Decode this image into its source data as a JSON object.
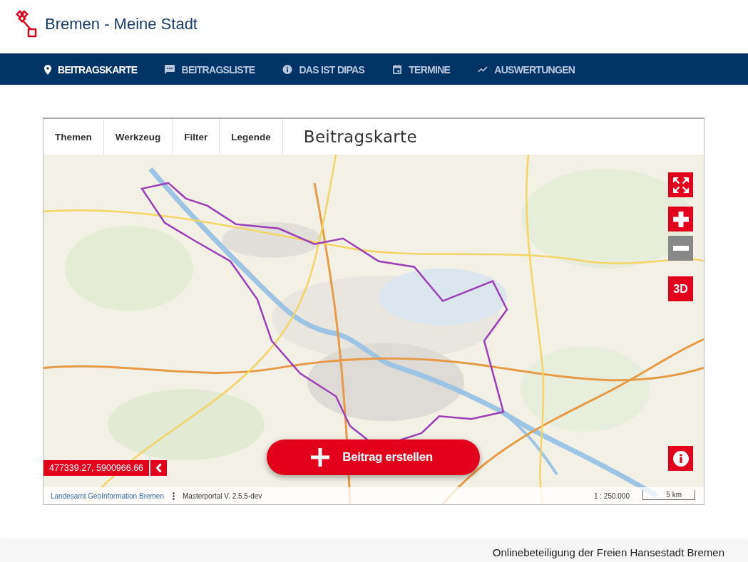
{
  "header": {
    "title": "Bremen - Meine Stadt"
  },
  "nav": [
    {
      "label": "BEITRAGSKARTE",
      "selected": true
    },
    {
      "label": "BEITRAGSLISTE",
      "selected": false
    },
    {
      "label": "DAS IST DIPAS",
      "selected": false
    },
    {
      "label": "TERMINE",
      "selected": false
    },
    {
      "label": "AUSWERTUNGEN",
      "selected": false
    }
  ],
  "map": {
    "tabs": [
      {
        "label": "Themen"
      },
      {
        "label": "Werkzeug"
      },
      {
        "label": "Filter"
      },
      {
        "label": "Legende"
      }
    ],
    "title": "Beitragskarte",
    "controls": [
      {
        "kind": "fullscreen",
        "disabled": false
      },
      {
        "kind": "zoomin",
        "disabled": false
      },
      {
        "kind": "zoomout",
        "disabled": true
      },
      {
        "kind": "perspective",
        "label": "3D",
        "disabled": false
      }
    ],
    "coordinates": "477339.27, 5900966.66",
    "create_button": "Beitrag erstellen",
    "attribution": "Landesamt GeoInformation Bremen",
    "version": "Masterportal V. 2.5.5-dev",
    "scale": "1 : 250.000",
    "scale_bar": "5 km"
  },
  "footer": {
    "text": "Onlinebeteiligung der Freien Hansestadt Bremen"
  }
}
